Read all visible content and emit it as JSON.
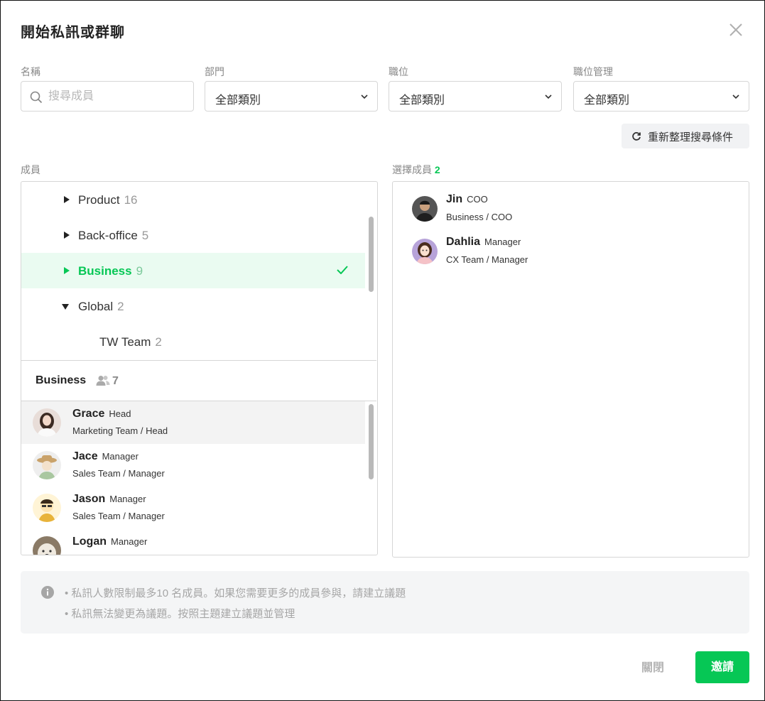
{
  "dialog": {
    "title": "開始私訊或群聊"
  },
  "filters": {
    "name_label": "名稱",
    "search_placeholder": "搜尋成員",
    "dept_label": "部門",
    "dept_value": "全部類別",
    "position_label": "職位",
    "position_value": "全部類別",
    "mgmt_label": "職位管理",
    "mgmt_value": "全部類別",
    "refresh_label": "重新整理搜尋條件"
  },
  "members_section": {
    "label": "成員",
    "departments": [
      {
        "name": "Product",
        "count": "16",
        "expanded": false,
        "selected": false
      },
      {
        "name": "Back-office",
        "count": "5",
        "expanded": false,
        "selected": false
      },
      {
        "name": "Business",
        "count": "9",
        "expanded": false,
        "selected": true
      },
      {
        "name": "Global",
        "count": "2",
        "expanded": true,
        "selected": false
      },
      {
        "name": "TW Team",
        "count": "2",
        "child": true
      }
    ],
    "group_header": {
      "name": "Business",
      "count": "7"
    },
    "members": [
      {
        "name": "Grace",
        "role": "Head",
        "sub": "Marketing Team / Head"
      },
      {
        "name": "Jace",
        "role": "Manager",
        "sub": "Sales Team / Manager"
      },
      {
        "name": "Jason",
        "role": "Manager",
        "sub": "Sales Team / Manager"
      },
      {
        "name": "Logan",
        "role": "Manager",
        "sub": ""
      }
    ]
  },
  "selected_section": {
    "label": "選擇成員",
    "count": "2",
    "members": [
      {
        "name": "Jin",
        "role": "COO",
        "sub": "Business / COO"
      },
      {
        "name": "Dahlia",
        "role": "Manager",
        "sub": "CX Team / Manager"
      }
    ]
  },
  "notice": {
    "line1": "• 私訊人數限制最多10 名成員。如果您需要更多的成員參與，請建立議題",
    "line2": "• 私訊無法變更為議題。按照主題建立議題並管理"
  },
  "footer": {
    "close_label": "關閉",
    "invite_label": "邀請"
  },
  "colors": {
    "accent": "#06c755",
    "selected_bg": "#eafbf1"
  }
}
